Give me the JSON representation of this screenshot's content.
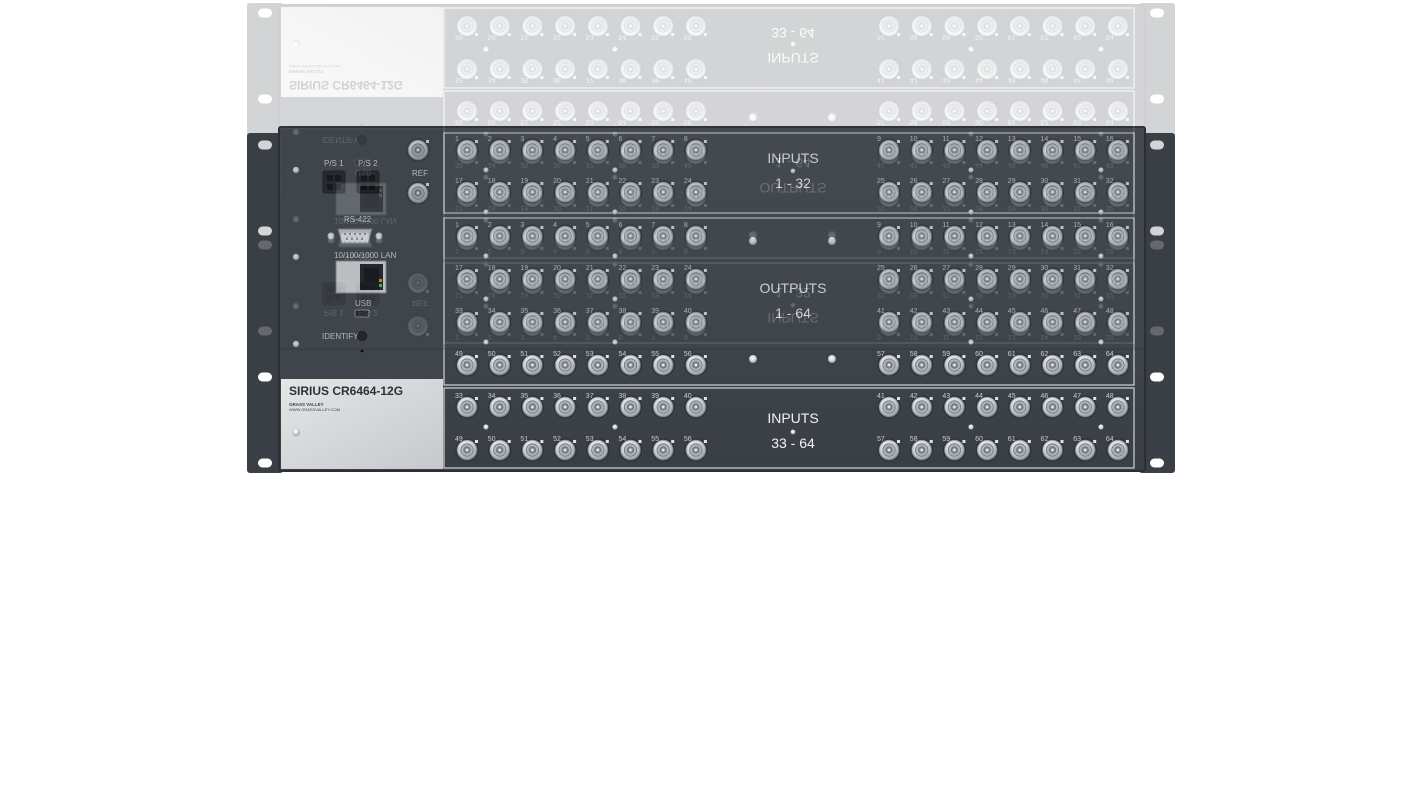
{
  "device": {
    "model": "SIRIUS CR6464-12G",
    "brand": "GRASS VALLEY",
    "website": "WWW.GRASSVALLEY.COM"
  },
  "control_panel": {
    "psu1": "P/S 1",
    "psu2": "P/S 2",
    "ref": "REF",
    "serial": "RS-422",
    "lan": "10/100/1000 LAN",
    "usb": "USB",
    "identify": "IDENTIFY"
  },
  "sections": [
    {
      "id": "inputs-1-32",
      "title": "INPUTS",
      "range": "1 - 32",
      "rows": [
        [
          1,
          8,
          9,
          16
        ],
        [
          17,
          24,
          25,
          32
        ]
      ]
    },
    {
      "id": "outputs-1-64",
      "title": "OUTPUTS",
      "range": "1 - 64",
      "rows": [
        [
          1,
          8,
          9,
          16
        ],
        [
          17,
          24,
          25,
          32
        ],
        [
          33,
          40,
          41,
          48
        ],
        [
          49,
          56,
          57,
          64
        ]
      ]
    },
    {
      "id": "inputs-33-64",
      "title": "INPUTS",
      "range": "33 - 64",
      "rows": [
        [
          33,
          40,
          41,
          48
        ],
        [
          49,
          56,
          57,
          64
        ]
      ]
    }
  ],
  "colors": {
    "panel": "#3e434a",
    "panel_edge": "#2e3238",
    "badge_plate": "#d8d9db",
    "connector_ring": "#e9ecef"
  }
}
